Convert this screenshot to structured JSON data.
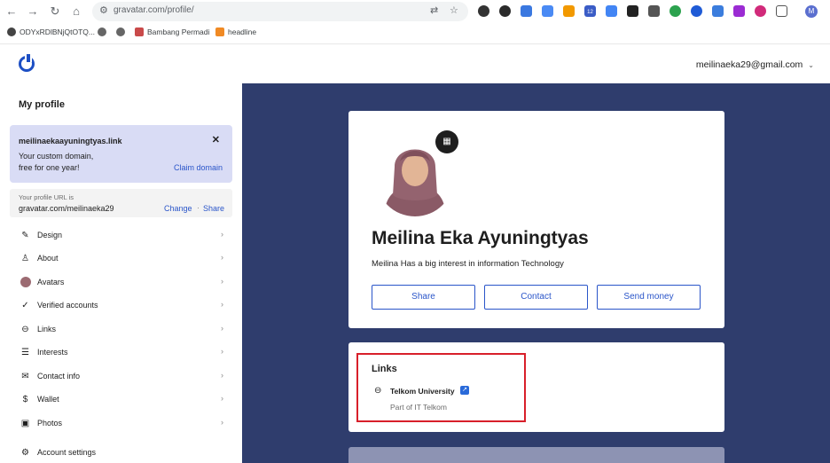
{
  "browser": {
    "url": "gravatar.com/profile/",
    "bookmarks": [
      "ODYxRDlBNjQtOTQ...",
      "Bambang Permadi",
      "headline"
    ],
    "extension_badge": "12",
    "profile_initial": "M"
  },
  "header": {
    "account_email": "meilinaeka29@gmail.com"
  },
  "sidebar": {
    "title": "My profile",
    "promo": {
      "domain": "meilinaekaayuningtyas.link",
      "line1": "Your custom domain,",
      "line2": "free for one year!",
      "claim": "Claim domain"
    },
    "profile_url": {
      "label": "Your profile URL is",
      "value": "gravatar.com/meilinaeka29",
      "change": "Change",
      "separator": "·",
      "share": "Share"
    },
    "items": [
      {
        "label": "Design",
        "icon": "brush-icon"
      },
      {
        "label": "About",
        "icon": "person-icon"
      },
      {
        "label": "Avatars",
        "icon": "avatar-thumb"
      },
      {
        "label": "Verified accounts",
        "icon": "verified-icon"
      },
      {
        "label": "Links",
        "icon": "link-icon"
      },
      {
        "label": "Interests",
        "icon": "interests-icon"
      },
      {
        "label": "Contact info",
        "icon": "mail-icon"
      },
      {
        "label": "Wallet",
        "icon": "wallet-icon"
      },
      {
        "label": "Photos",
        "icon": "photo-icon"
      },
      {
        "label": "Account settings",
        "icon": "gear-icon"
      }
    ]
  },
  "profile": {
    "name": "Meilina Eka Ayuningtyas",
    "bio": "Meilina Has a big interest in information Technology",
    "buttons": {
      "share": "Share",
      "contact": "Contact",
      "send_money": "Send money"
    }
  },
  "links_card": {
    "title": "Links",
    "items": [
      {
        "title": "Telkom University",
        "subtitle": "Part of IT Telkom"
      }
    ]
  },
  "colors": {
    "main_bg": "#2f3d6d",
    "accent": "#2a55c9",
    "promo_bg": "#d9dcf5",
    "highlight": "#d81f2a"
  }
}
